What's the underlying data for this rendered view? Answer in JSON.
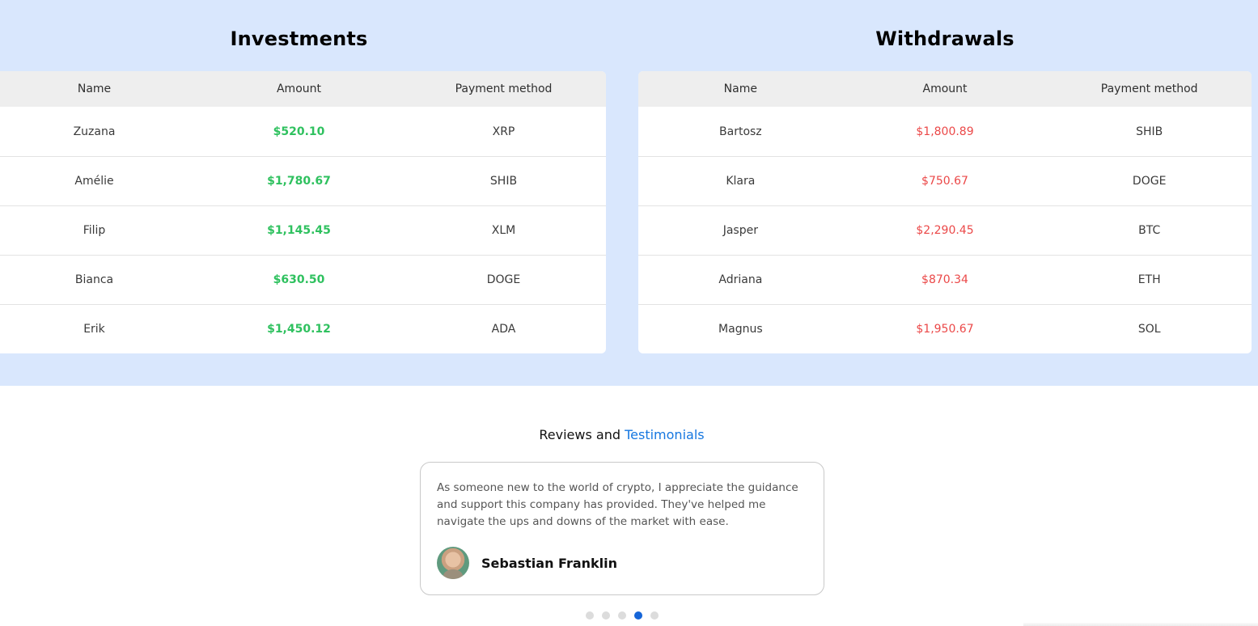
{
  "investments": {
    "title": "Investments",
    "headers": [
      "Name",
      "Amount",
      "Payment method"
    ],
    "rows": [
      {
        "name": "Zuzana",
        "amount": "$520.10",
        "method": "XRP"
      },
      {
        "name": "Amélie",
        "amount": "$1,780.67",
        "method": "SHIB"
      },
      {
        "name": "Filip",
        "amount": "$1,145.45",
        "method": "XLM"
      },
      {
        "name": "Bianca",
        "amount": "$630.50",
        "method": "DOGE"
      },
      {
        "name": "Erik",
        "amount": "$1,450.12",
        "method": "ADA"
      }
    ]
  },
  "withdrawals": {
    "title": "Withdrawals",
    "headers": [
      "Name",
      "Amount",
      "Payment method"
    ],
    "rows": [
      {
        "name": "Bartosz",
        "amount": "$1,800.89",
        "method": "SHIB"
      },
      {
        "name": "Klara",
        "amount": "$750.67",
        "method": "DOGE"
      },
      {
        "name": "Jasper",
        "amount": "$2,290.45",
        "method": "BTC"
      },
      {
        "name": "Adriana",
        "amount": "$870.34",
        "method": "ETH"
      },
      {
        "name": "Magnus",
        "amount": "$1,950.67",
        "method": "SOL"
      }
    ]
  },
  "reviews": {
    "heading_plain": "Reviews and",
    "heading_accent": "Testimonials",
    "testimonial_text": "As someone new to the world of crypto, I appreciate the guidance and support this company has provided. They've helped me navigate the ups and downs of the market with ease.",
    "reviewer_name": "Sebastian Franklin",
    "avatar_icon": "person-avatar",
    "carousel_total": 5,
    "carousel_active": 4
  },
  "colors": {
    "section_bg": "#d9e7fd",
    "investment_amount": "#2fc15f",
    "withdrawal_amount": "#eb4848",
    "accent": "#1677e0",
    "active_dot": "#1565d8"
  }
}
